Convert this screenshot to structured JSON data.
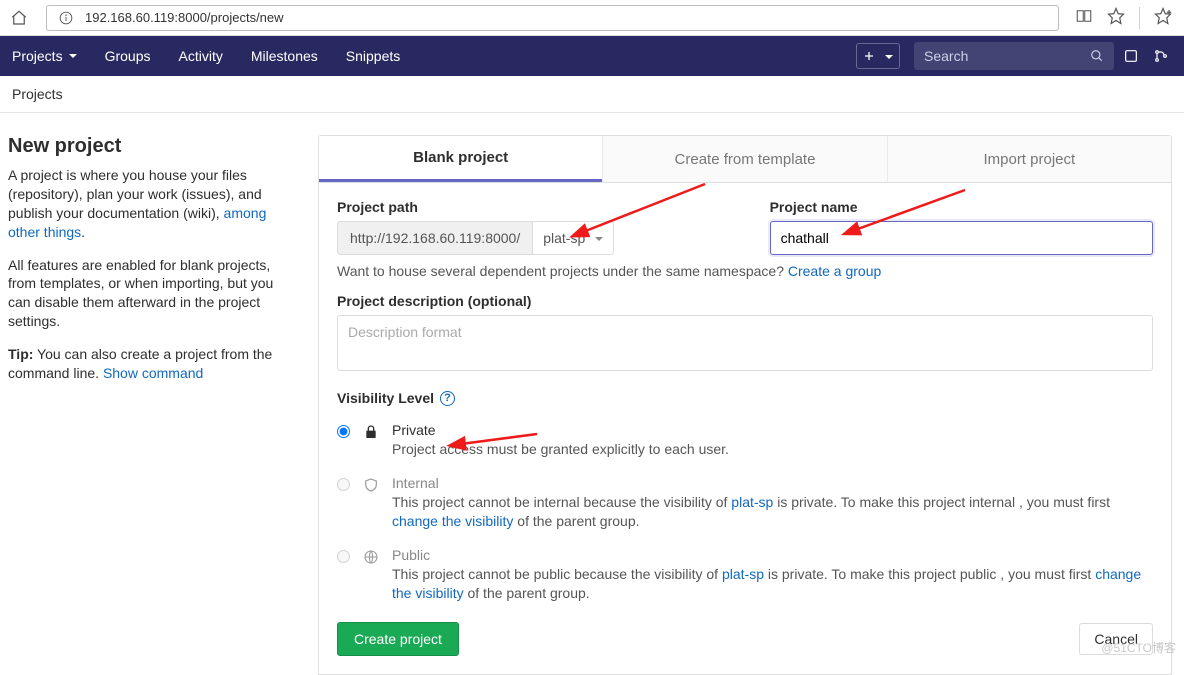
{
  "browser": {
    "url": "192.168.60.119:8000/projects/new"
  },
  "nav": {
    "items": [
      "Projects",
      "Groups",
      "Activity",
      "Milestones",
      "Snippets"
    ],
    "search_placeholder": "Search"
  },
  "breadcrumb": "Projects",
  "page": {
    "title": "New project",
    "desc1_a": "A project is where you house your files (repository), plan your work (issues), and publish your documentation (wiki), ",
    "desc1_link": "among other things",
    "desc1_b": ".",
    "desc2": "All features are enabled for blank projects, from templates, or when importing, but you can disable them afterward in the project settings.",
    "tip_label": "Tip:",
    "tip_text": " You can also create a project from the command line. ",
    "tip_link": "Show command"
  },
  "tabs": {
    "blank": "Blank project",
    "template": "Create from template",
    "import": "Import project"
  },
  "form": {
    "path_label": "Project path",
    "path_base": "http://192.168.60.119:8000/",
    "path_namespace": "plat-sp",
    "name_label": "Project name",
    "name_value": "chathall",
    "hint_text": "Want to house several dependent projects under the same namespace? ",
    "hint_link": "Create a group",
    "desc_label": "Project description (optional)",
    "desc_placeholder": "Description format",
    "vis_label": "Visibility Level",
    "vis": {
      "private": {
        "title": "Private",
        "desc": "Project access must be granted explicitly to each user."
      },
      "internal": {
        "title": "Internal",
        "d1": "This project cannot be internal because the visibility of ",
        "ns": "plat-sp",
        "d2": " is private. To make this project internal , you must first ",
        "lnk": "change the visibility",
        "d3": " of the parent group."
      },
      "public": {
        "title": "Public",
        "d1": "This project cannot be public because the visibility of ",
        "ns": "plat-sp",
        "d2": " is private. To make this project public , you must first ",
        "lnk": "change the visibility",
        "d3": " of the parent group."
      }
    },
    "submit": "Create project",
    "cancel": "Cancel"
  },
  "watermark": "@51CTO博客"
}
